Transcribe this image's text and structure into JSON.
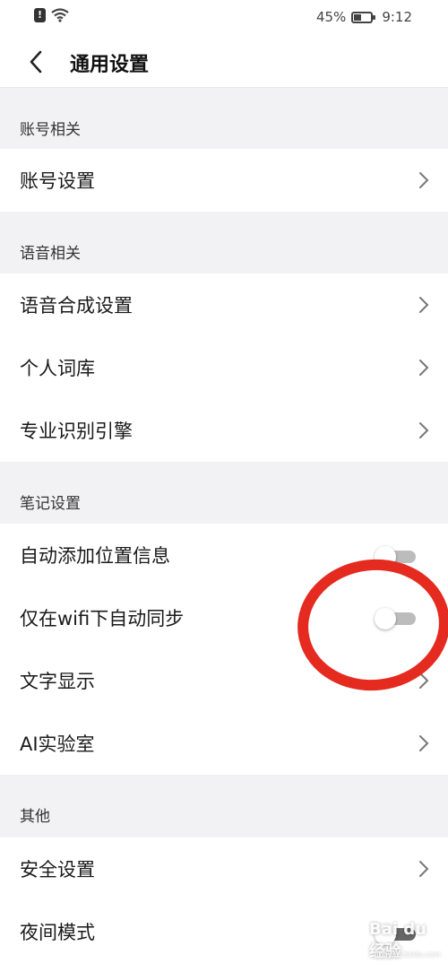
{
  "status_bar": {
    "battery": "45%",
    "time": "9:12"
  },
  "header": {
    "title": "通用设置"
  },
  "sections": [
    {
      "title": "账号相关",
      "items": [
        {
          "label": "账号设置"
        }
      ]
    },
    {
      "title": "语音相关",
      "items": [
        {
          "label": "语音合成设置"
        },
        {
          "label": "个人词库"
        },
        {
          "label": "专业识别引擎"
        }
      ]
    },
    {
      "title": "笔记设置",
      "items": [
        {
          "label": "自动添加位置信息"
        },
        {
          "label": "仅在wifi下自动同步"
        },
        {
          "label": "文字显示"
        },
        {
          "label": "AI实验室"
        }
      ]
    },
    {
      "title": "其他",
      "items": [
        {
          "label": "安全设置"
        },
        {
          "label": "夜间模式"
        }
      ]
    }
  ],
  "watermark": {
    "text": "Bai du 经验",
    "sub": "jingyan.baidu.com"
  },
  "colors": {
    "annotation": "#e52a1f",
    "toggle_off": "#bcbcbc"
  }
}
